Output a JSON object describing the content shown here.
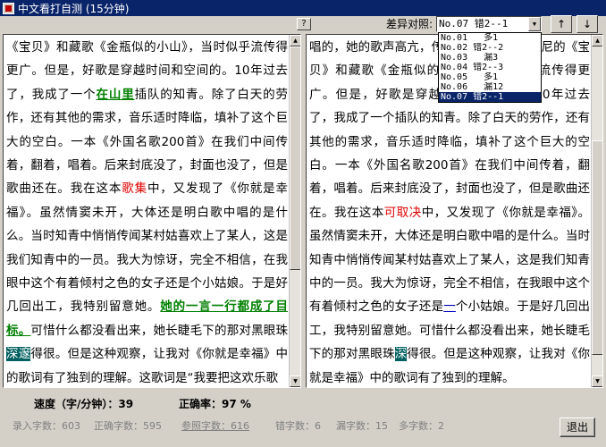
{
  "window": {
    "title": "中文看打自测 (15分钟)"
  },
  "toolbar": {
    "help_label": "?",
    "diff_label": "差异对照:",
    "diff_selected": "No.07 错2--1",
    "up_label": "↑",
    "down_label": "↓"
  },
  "diff_options": [
    "No.01   多1",
    "No.02 错2--2",
    "No.03   漏3",
    "No.04 错2--3",
    "No.05   多1",
    "No.06   漏12",
    "No.07 错2--1"
  ],
  "left_text": [
    {
      "t": "《宝贝》和藏歌《金瓶似的小山》，当时似乎流传得更广。但是，好歌是穿越时间和空间的。",
      "c": "ok"
    },
    {
      "t": "10年过去了，我成了一个",
      "c": "ok"
    },
    {
      "t": "在山里",
      "c": "cur"
    },
    {
      "t": "插队的知青。除了白天的劳作，还有其他的需求，音乐适时降临，填补了这个巨大的空白。一本《外国名歌200首》在我们中间传着，翻着，唱着。后来封底没了，封面也没了，但是歌曲还在。我在这本",
      "c": "ok"
    },
    {
      "t": "歌集",
      "c": "err"
    },
    {
      "t": "中，又发现了《你就是幸福》。虽然情窦未开，大体还是明白歌中唱的是什么。当时知青中悄悄传闻某村姑喜欢上了某人，这是我们知青中的一员。我大为惊讶，完全不相信，在我眼中这个有着倾村之色的女子还是个小姑娘。于是好几回出工，我特别留意她。",
      "c": "ok"
    },
    {
      "t": "她的一言一行都成了目标。",
      "c": "cur"
    },
    {
      "t": "可惜什么都没看出来，她长睫毛下的那对黑眼珠",
      "c": "ok"
    },
    {
      "t": "深邃",
      "c": "hl"
    },
    {
      "t": "得很。但是这种观察，让我对《你就是幸福》中的歌词有了独到的理解。这歌词是“我要把这欢乐歌",
      "c": "ok"
    }
  ],
  "right_text": [
    {
      "t": "唱的，她的歌声高亢，传遍了四方，除了印尼的《宝贝》和藏歌《金瓶似的小山》，当时似乎流传得更广。但是，好歌是穿越时间和空间的。",
      "c": "ok"
    },
    {
      "t": "10年过去了，我成了一个插队的知青。除了白天的劳作，还有其他的需求，音乐适时降临，填补了这个巨大的空白。一本《外国名歌200首》在我们中间传着，翻着，唱着。后来封底没了，封面也没了，但是歌曲还在。我在这本",
      "c": "ok"
    },
    {
      "t": "可取决",
      "c": "err"
    },
    {
      "t": "中，又发现了《你就是幸福》。虽然情窦未开，大体还是明白歌中唱的是什么。当时知青中悄悄传闻某村姑喜欢上了某人，这是我们知青中的一员。我大为惊讶，完全不相信，在我眼中这个有着倾村之色的女子还是",
      "c": "ok"
    },
    {
      "t": "一",
      "c": "blue"
    },
    {
      "t": "个小姑娘。于是好几回出工，我特别留意她。可惜什么都没看出来，她长睫毛下的那对黑眼珠",
      "c": "ok"
    },
    {
      "t": "深",
      "c": "hl"
    },
    {
      "t": "得很。但是这种观察，让我对《你就是幸福》中的歌词有了独到的理解。",
      "c": "ok"
    }
  ],
  "stats": {
    "speed_label": "速度（字/分钟）：",
    "speed_value": "39",
    "accuracy_label": "正确率：",
    "accuracy_value": "97 %",
    "typed_label": "录入字数：",
    "typed_value": "603",
    "correct_label": "正确字数：",
    "correct_value": "595",
    "ref_label": "参照字数：",
    "ref_value": "616",
    "wrong_label": "错字数：",
    "wrong_value": "6",
    "missing_label": "漏字数：",
    "missing_value": "15",
    "extra_label": "多字数：",
    "extra_value": "2"
  },
  "exit_label": "退出"
}
